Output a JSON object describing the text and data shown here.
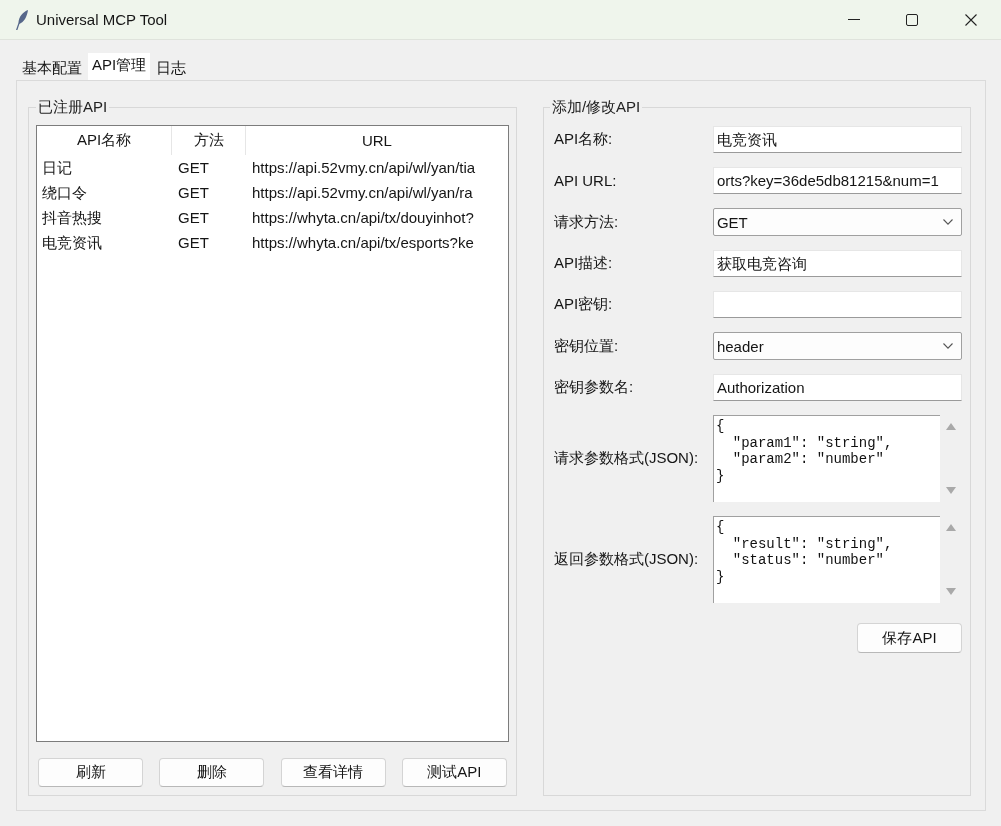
{
  "window": {
    "title": "Universal MCP Tool"
  },
  "tabs": [
    {
      "label": "基本配置",
      "selected": false
    },
    {
      "label": "API管理",
      "selected": true
    },
    {
      "label": "日志",
      "selected": false
    }
  ],
  "registered_apis": {
    "title": "已注册API",
    "columns": [
      "API名称",
      "方法",
      "URL"
    ],
    "rows": [
      {
        "name": "日记",
        "method": "GET",
        "url": "https://api.52vmy.cn/api/wl/yan/tia"
      },
      {
        "name": "绕口令",
        "method": "GET",
        "url": "https://api.52vmy.cn/api/wl/yan/ra"
      },
      {
        "name": "抖音热搜",
        "method": "GET",
        "url": "https://whyta.cn/api/tx/douyinhot?"
      },
      {
        "name": "电竞资讯",
        "method": "GET",
        "url": "https://whyta.cn/api/tx/esports?ke"
      }
    ],
    "buttons": [
      "刷新",
      "删除",
      "查看详情",
      "测试API"
    ]
  },
  "api_form": {
    "title": "添加/修改API",
    "fields": [
      {
        "kind": "entry",
        "label": "API名称:",
        "value": "电竞资讯"
      },
      {
        "kind": "entry",
        "label": "API URL:",
        "value": "orts?key=36de5db81215&num=1"
      },
      {
        "kind": "combobox",
        "label": "请求方法:",
        "value": "GET"
      },
      {
        "kind": "entry",
        "label": "API描述:",
        "value": "获取电竞咨询"
      },
      {
        "kind": "entry",
        "label": "API密钥:"
      },
      {
        "kind": "combobox",
        "label": "密钥位置:",
        "value": "header"
      },
      {
        "kind": "entry",
        "label": "密钥参数名:",
        "value": "Authorization"
      },
      {
        "kind": "text_area",
        "label": "请求参数格式(JSON):",
        "value": "{\n  \"param1\": \"string\",\n  \"param2\": \"number\"\n}"
      },
      {
        "kind": "text_area",
        "label": "返回参数格式(JSON):",
        "value": "{\n  \"result\": \"string\",\n  \"status\": \"number\"\n}"
      }
    ],
    "save_button": "保存API"
  }
}
